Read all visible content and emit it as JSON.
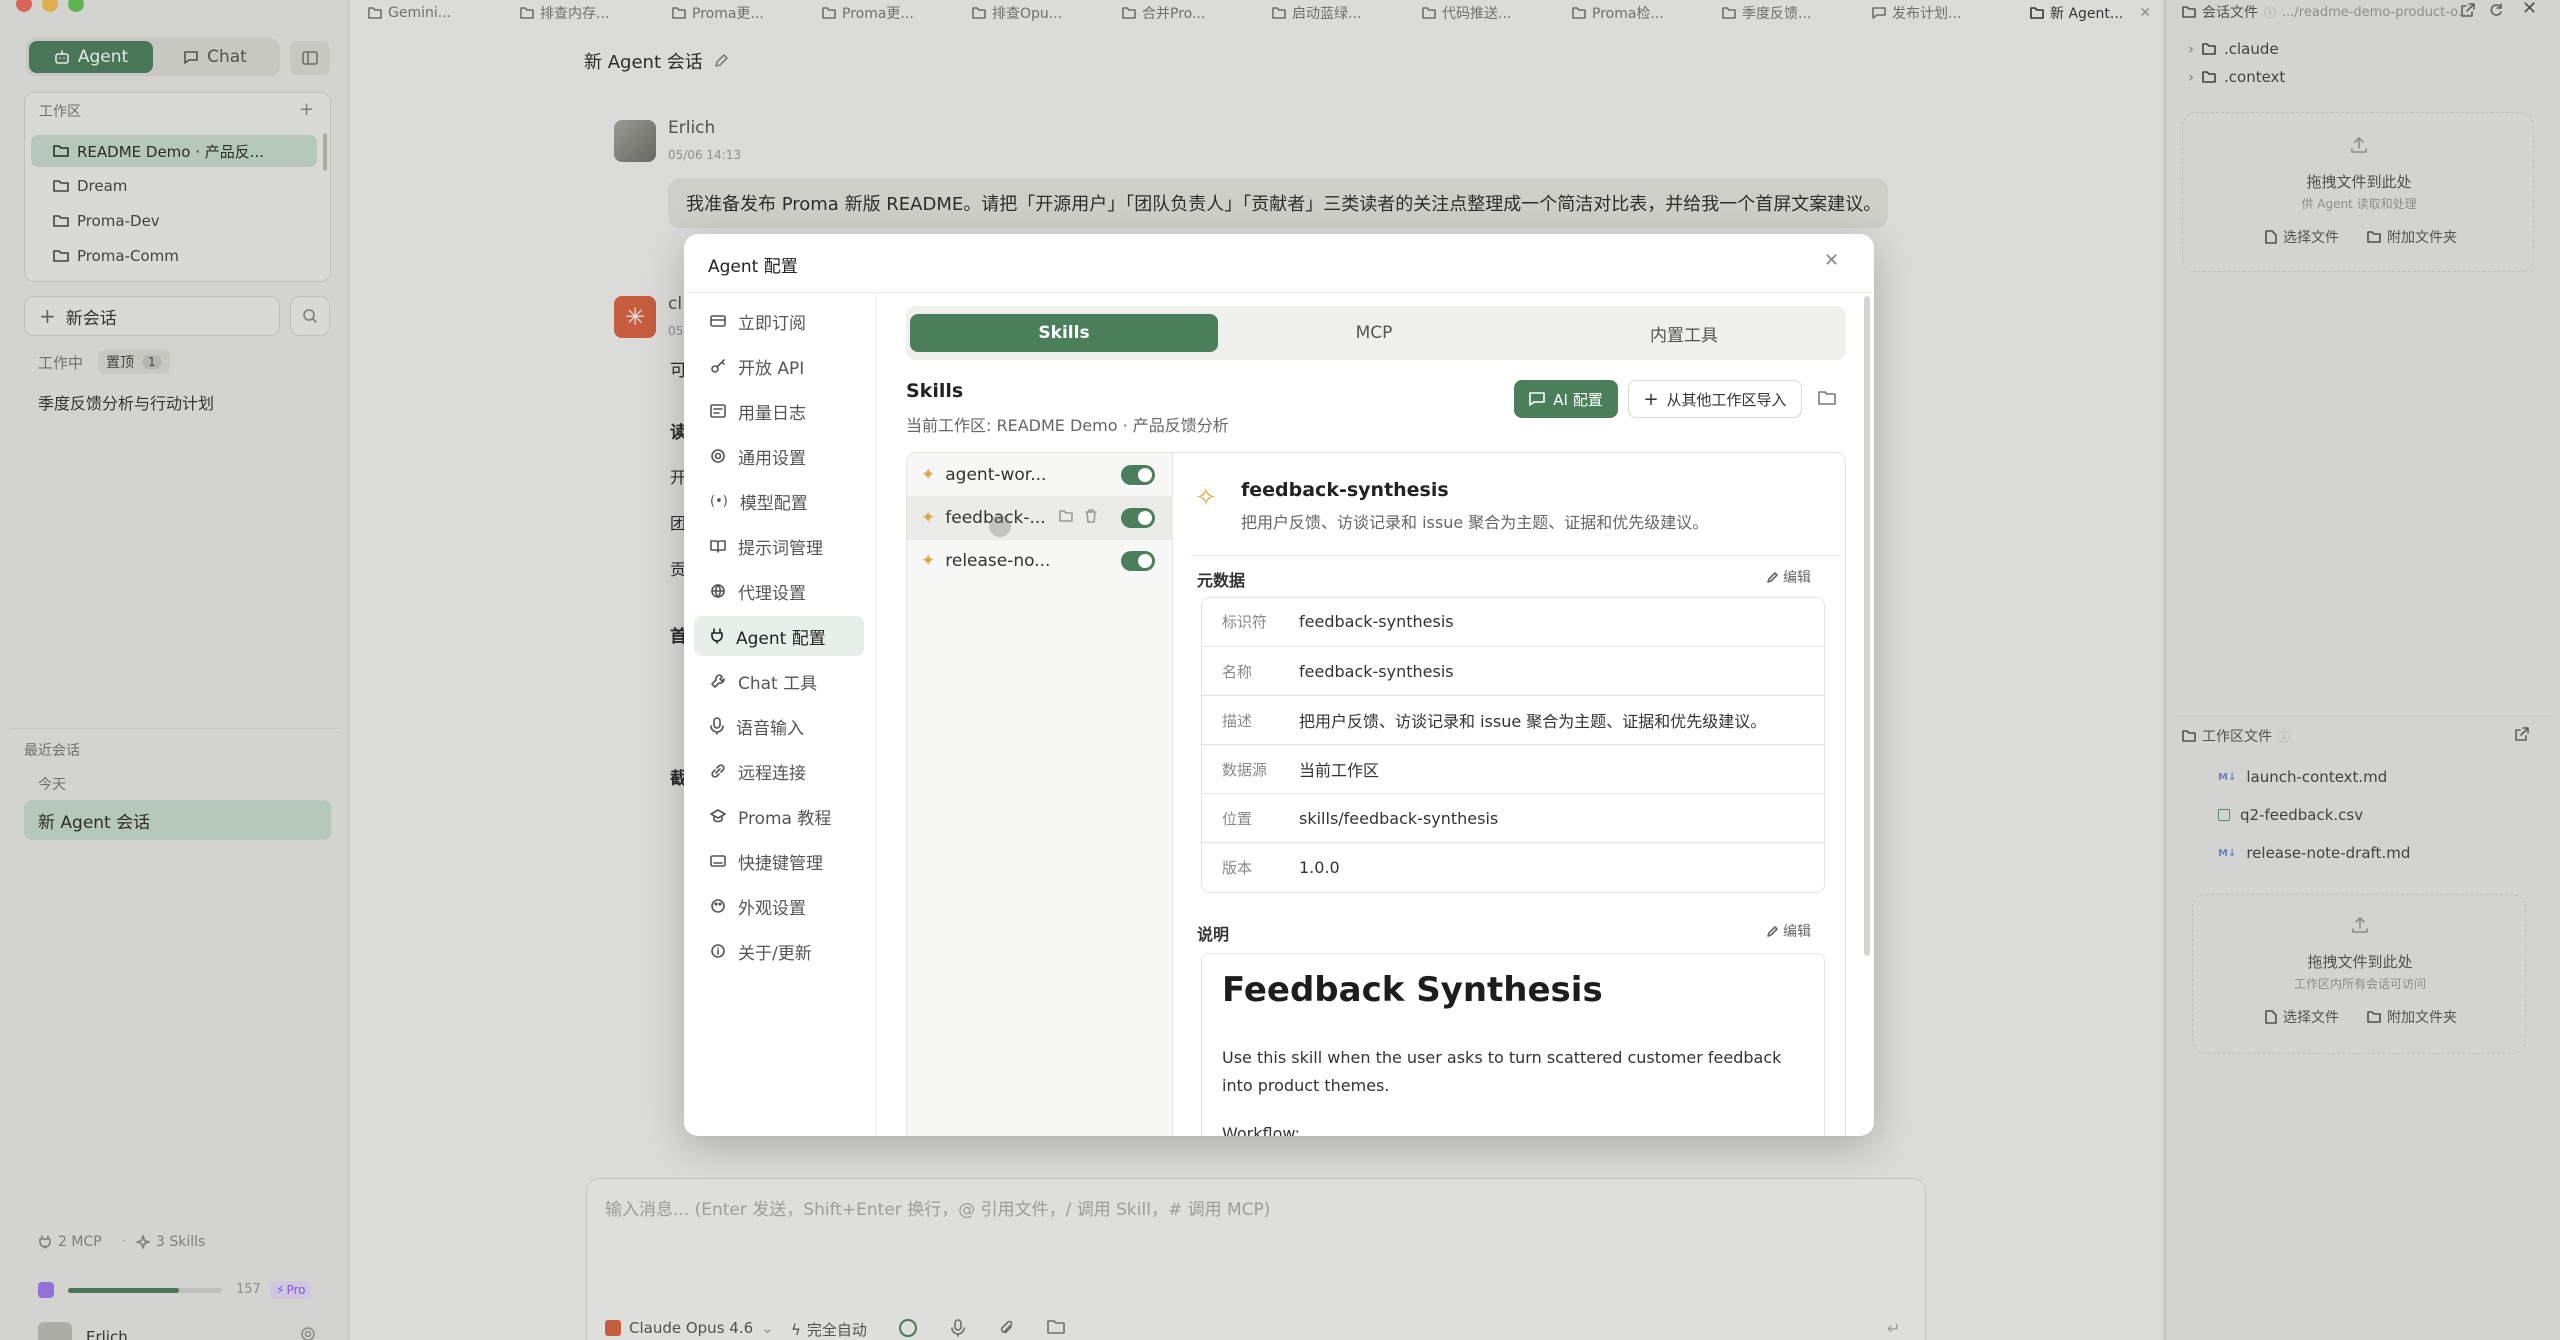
{
  "sidebar": {
    "mode_tabs": {
      "agent": "Agent",
      "chat": "Chat"
    },
    "workspace_heading": "工作区",
    "workspaces": [
      "README Demo · 产品反...",
      "Dream",
      "Proma-Dev",
      "Proma-Comm"
    ],
    "new_session": "新会话",
    "working_label": "工作中",
    "pinned_label": "置顶",
    "pinned_count": "1",
    "pinned_item": "季度反馈分析与行动计划",
    "recent_heading": "最近会话",
    "today_label": "今天",
    "current_session": "新 Agent 会话",
    "mcp_count": "2 MCP",
    "skills_count": "3 Skills",
    "usage_number": "157",
    "usage_progress": 0.72,
    "plan_badge": "Pro",
    "user_name": "Erlich"
  },
  "tabs": [
    "Gemini...",
    "排查内存...",
    "Proma更...",
    "Proma更...",
    "排查Opu...",
    "合并Pro...",
    "启动蓝绿...",
    "代码推送...",
    "Proma检...",
    "季度反馈...",
    "发布计划...",
    "新 Agent..."
  ],
  "main": {
    "title": "新 Agent 会话",
    "user_name": "Erlich",
    "user_time": "05/06 14:13",
    "user_message": "我准备发布 Proma 新版 README。请把「开源用户」「团队负责人」「贡献者」三类读者的关注点整理成一个简洁对比表，并给我一个首屏文案建议。",
    "assistant_initials": "cl",
    "assistant_time": "05",
    "peek": [
      "可",
      "读",
      "开",
      "团",
      "贡",
      "首",
      "截"
    ],
    "composer_placeholder": "输入消息... (Enter 发送，Shift+Enter 换行，@ 引用文件，/ 调用 Skill，# 调用 MCP)",
    "model_name": "Claude Opus 4.6",
    "auto_mode": "完全自动"
  },
  "right_panel": {
    "session_files_label": "会话文件",
    "session_path": ".../readme-demo-product-o...",
    "tree": [
      ".claude",
      ".context"
    ],
    "drop1_title": "拖拽文件到此处",
    "drop1_sub": "供 Agent 读取和处理",
    "choose_file": "选择文件",
    "attach_folder": "附加文件夹",
    "workspace_files_label": "工作区文件",
    "files": [
      "launch-context.md",
      "q2-feedback.csv",
      "release-note-draft.md"
    ],
    "drop2_title": "拖拽文件到此处",
    "drop2_sub": "工作区内所有会话可访问"
  },
  "modal": {
    "title": "Agent 配置",
    "nav": [
      "立即订阅",
      "开放 API",
      "用量日志",
      "通用设置",
      "模型配置",
      "提示词管理",
      "代理设置",
      "Agent 配置",
      "Chat 工具",
      "语音输入",
      "远程连接",
      "Proma 教程",
      "快捷键管理",
      "外观设置",
      "关于/更新"
    ],
    "tabs": [
      "Skills",
      "MCP",
      "内置工具"
    ],
    "section_title": "Skills",
    "section_sub": "当前工作区: README Demo · 产品反馈分析",
    "ai_config": "AI 配置",
    "import_label": "从其他工作区导入",
    "skills": [
      "agent-wor...",
      "feedback-...",
      "release-no..."
    ],
    "detail": {
      "name": "feedback-synthesis",
      "desc": "把用户反馈、访谈记录和 issue 聚合为主题、证据和优先级建议。",
      "meta_heading": "元数据",
      "edit": "编辑",
      "meta": [
        {
          "k": "标识符",
          "v": "feedback-synthesis"
        },
        {
          "k": "名称",
          "v": "feedback-synthesis"
        },
        {
          "k": "描述",
          "v": "把用户反馈、访谈记录和 issue 聚合为主题、证据和优先级建议。"
        },
        {
          "k": "数据源",
          "v": "当前工作区"
        },
        {
          "k": "位置",
          "v": "skills/feedback-synthesis"
        },
        {
          "k": "版本",
          "v": "1.0.0"
        }
      ],
      "doc_heading": "说明",
      "doc_title": "Feedback Synthesis",
      "doc_body": "Use this skill when the user asks to turn scattered customer feedback into product themes.",
      "doc_workflow": "Workflow:"
    }
  },
  "colors": {
    "accent": "#4b7f5c",
    "brand_orange": "#d9623f",
    "pro_purple": "#8b5cf6"
  }
}
